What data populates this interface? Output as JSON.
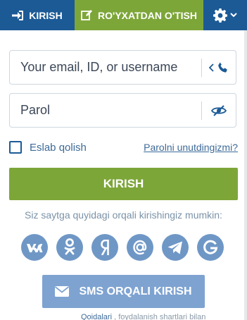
{
  "tabs": {
    "login": "KIRISH",
    "register": "RO'YXATDAN O'TISH"
  },
  "form": {
    "username_placeholder": "Your email, ID, or username",
    "password_placeholder": "Parol",
    "remember_label": "Eslab qolish",
    "forgot_link": "Parolni unutdingizmi?",
    "submit_label": "KIRISH"
  },
  "social": {
    "text": "Siz saytga quyidagi orqali kirishingiz mumkin:",
    "providers": [
      {
        "name": "VK",
        "icon": "vk-icon"
      },
      {
        "name": "Odnoklassniki",
        "icon": "odnoklassniki-icon"
      },
      {
        "name": "Yandex",
        "icon": "yandex-icon"
      },
      {
        "name": "Mail.ru",
        "icon": "at-sign-icon"
      },
      {
        "name": "Telegram",
        "icon": "telegram-icon"
      },
      {
        "name": "Google",
        "icon": "google-icon"
      }
    ]
  },
  "sms_button": "SMS ORQALI KIRISH",
  "footer_partial": {
    "link": "Qoidalari",
    "text": " , foydalanish shartlari bilan"
  },
  "colors": {
    "primary_blue": "#1c5a96",
    "green": "#7da639",
    "social_blue": "#6f97c6",
    "sms_blue": "#7ea3d1"
  }
}
